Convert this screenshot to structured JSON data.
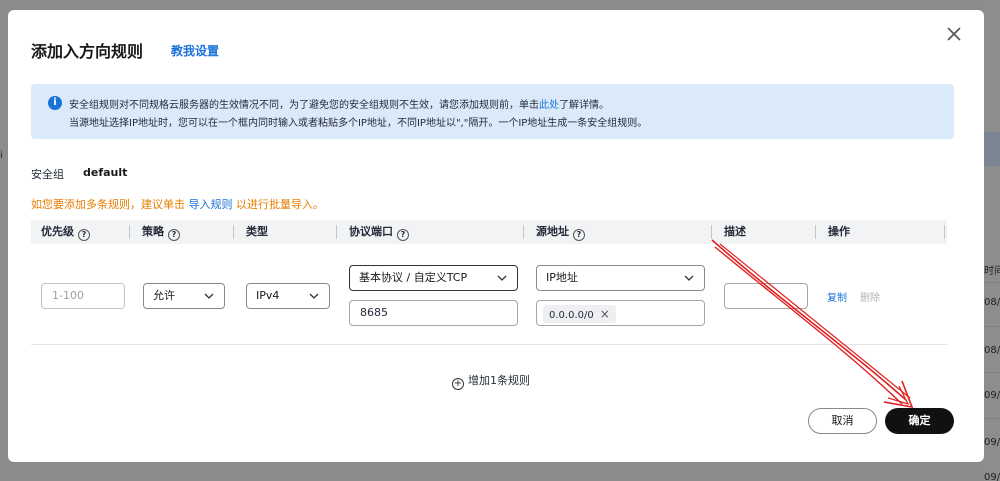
{
  "background": {
    "left_fragment": "i",
    "right_fragments": [
      "时间",
      "08/",
      "08/",
      "09/",
      "09/",
      "09/"
    ]
  },
  "dialog": {
    "title": "添加入方向规则",
    "help_link": "教我设置",
    "close_icon": "close-icon"
  },
  "info": {
    "icon": "info-icon",
    "line1_before": "安全组规则对不同规格云服务器的生效情况不同，为了避免您的安全组规则不生效，请您添加规则前，单击",
    "line1_link": "此处",
    "line1_after": "了解详情。",
    "line2": "当源地址选择IP地址时，您可以在一个框内同时输入或者粘贴多个IP地址，不同IP地址以\",\"隔开。一个IP地址生成一条安全组规则。"
  },
  "security_group": {
    "label": "安全组",
    "value": "default"
  },
  "warning": {
    "before": "如您要添加多条规则，建议单击 ",
    "link": "导入规则",
    "after": " 以进行批量导入。"
  },
  "table": {
    "headers": {
      "priority": "优先级",
      "policy": "策略",
      "type": "类型",
      "port": "协议端口",
      "source": "源地址",
      "description": "描述",
      "operation": "操作"
    },
    "row": {
      "priority_placeholder": "1-100",
      "policy": "允许",
      "type": "IPv4",
      "protocol": "基本协议 / 自定义TCP",
      "port": "8685",
      "source_type": "IP地址",
      "source_value": "0.0.0.0/0",
      "description": "",
      "op_copy": "复制",
      "op_delete": "删除"
    }
  },
  "add_rule": "增加1条规则",
  "buttons": {
    "cancel": "取消",
    "ok": "确定"
  },
  "colors": {
    "accent": "#1a73d9",
    "warning": "#e67e00",
    "info_bg": "#dbeafb",
    "annotation_arrow": "#e02020"
  }
}
